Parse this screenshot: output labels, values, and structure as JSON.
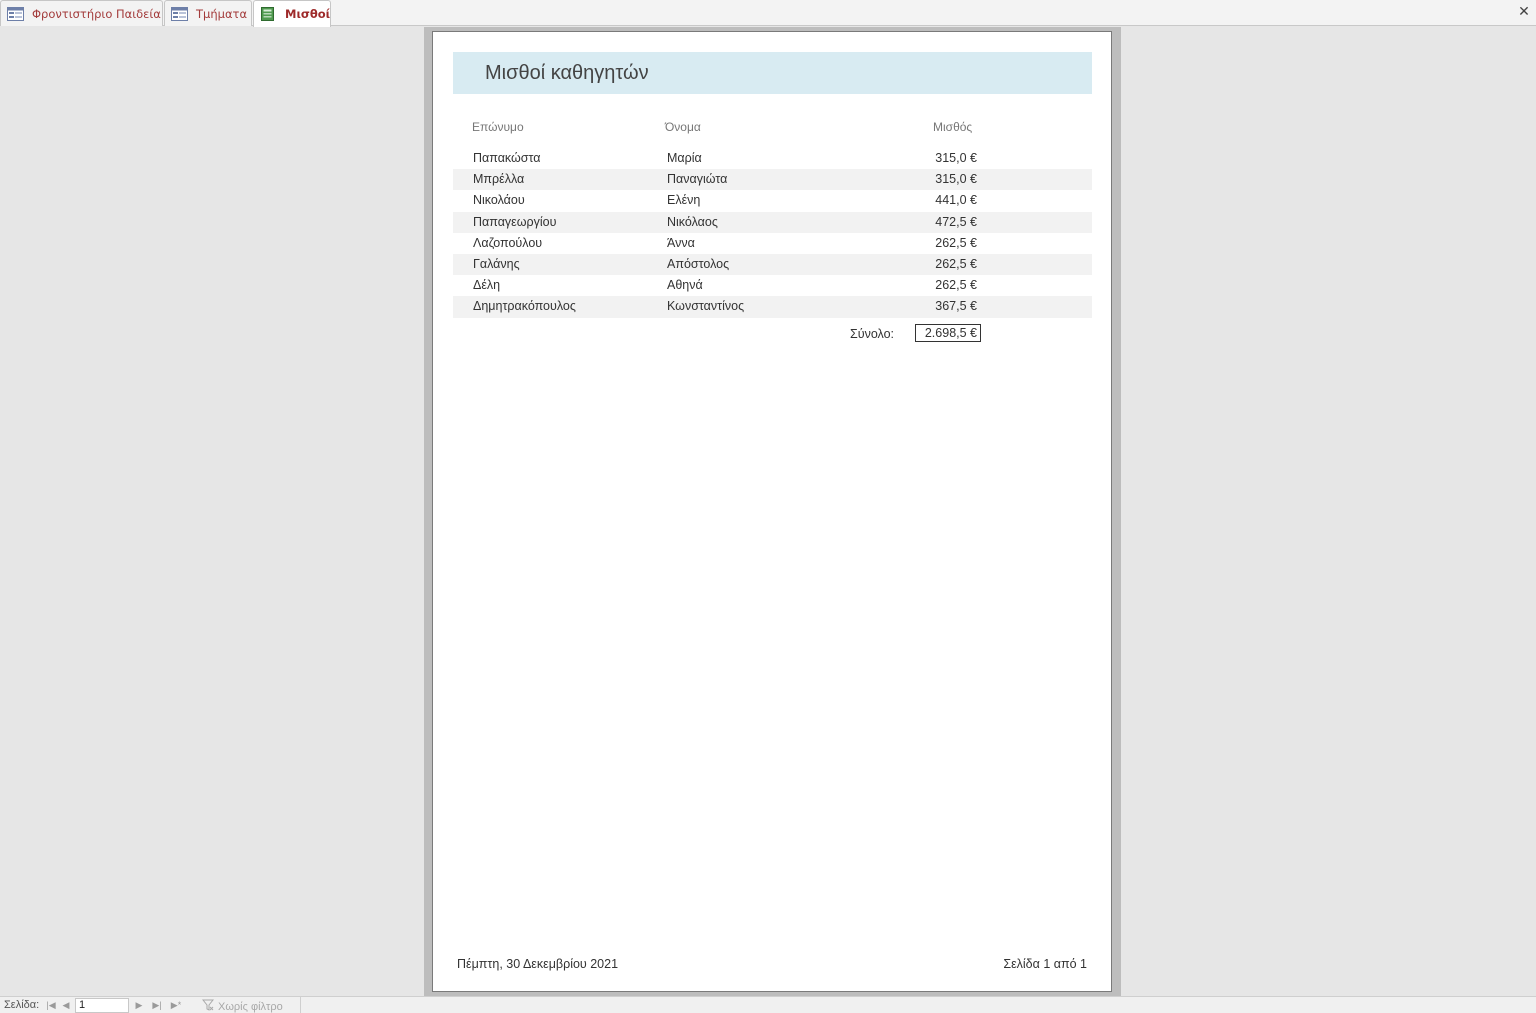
{
  "tabs": [
    {
      "label": "Φροντιστήριο Παιδεία",
      "icon": "form-icon",
      "active": false
    },
    {
      "label": "Τμήματα",
      "icon": "form-icon",
      "active": false
    },
    {
      "label": "Μισθοί",
      "icon": "report-icon",
      "active": true
    }
  ],
  "report": {
    "title": "Μισθοί καθηγητών",
    "columns": {
      "last_name": "Επώνυμο",
      "first_name": "Όνομα",
      "salary": "Μισθός"
    },
    "rows": [
      {
        "last_name": "Παπακώστα",
        "first_name": "Μαρία",
        "salary": "315,0 €"
      },
      {
        "last_name": "Μπρέλλα",
        "first_name": "Παναγιώτα",
        "salary": "315,0 €"
      },
      {
        "last_name": "Νικολάου",
        "first_name": "Ελένη",
        "salary": "441,0 €"
      },
      {
        "last_name": "Παπαγεωργίου",
        "first_name": "Νικόλαος",
        "salary": "472,5 €"
      },
      {
        "last_name": "Λαζοπούλου",
        "first_name": "Άννα",
        "salary": "262,5 €"
      },
      {
        "last_name": "Γαλάνης",
        "first_name": "Απόστολος",
        "salary": "262,5 €"
      },
      {
        "last_name": "Δέλη",
        "first_name": "Αθηνά",
        "salary": "262,5 €"
      },
      {
        "last_name": "Δημητρακόπουλος",
        "first_name": "Κωνσταντίνος",
        "salary": "367,5 €"
      }
    ],
    "total_label": "Σύνολο:",
    "total_value": "2.698,5 €",
    "footer_date": "Πέμπτη, 30 Δεκεμβρίου 2021",
    "footer_page": "Σελίδα 1 από 1"
  },
  "navigation": {
    "page_label": "Σελίδα:",
    "page_value": "1",
    "filter_label": "Χωρίς φίλτρο"
  },
  "colors": {
    "header_band": "#d8ebf2",
    "tab_text": "#a33b3b",
    "alt_row": "#f2f2f2"
  }
}
